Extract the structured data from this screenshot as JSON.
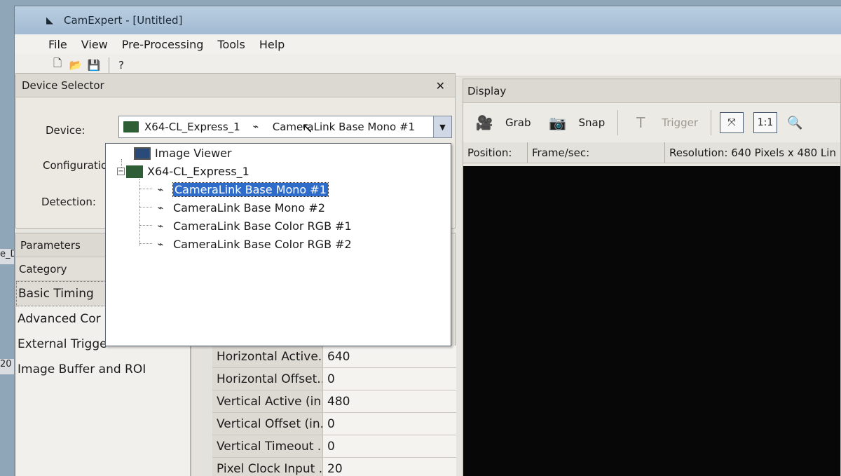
{
  "desktop": {
    "frag1": "e_D",
    "frag2": "20"
  },
  "window": {
    "title": "CamExpert - [Untitled]"
  },
  "menu": [
    "File",
    "View",
    "Pre-Processing",
    "Tools",
    "Help"
  ],
  "toolbar": {
    "icons": [
      "new-file-icon",
      "open-folder-icon",
      "save-icon",
      "help-icon"
    ]
  },
  "device_selector": {
    "header": "Device Selector",
    "device_label": "Device:",
    "configuration_label": "Configuration:",
    "detection_label": "Detection:",
    "selected_board": "X64-CL_Express_1",
    "selected_camera": "CameraLink Base Mono #1"
  },
  "dropdown": {
    "image_viewer": "Image Viewer",
    "board": "X64-CL_Express_1",
    "items": [
      "CameraLink Base Mono #1",
      "CameraLink Base Mono #2",
      "CameraLink Base Color RGB #1",
      "CameraLink Base Color RGB #2"
    ],
    "selected_index": 0
  },
  "parameters": {
    "header": "Parameters",
    "category_header": "Category",
    "categories": [
      "Basic Timing",
      "Advanced Cor",
      "External Trigge",
      "Image Buffer and ROI"
    ]
  },
  "grid": {
    "rows": [
      {
        "name": "Horizontal Active...",
        "value": "640"
      },
      {
        "name": "Horizontal Offset...",
        "value": "0"
      },
      {
        "name": "Vertical Active (in...",
        "value": "480"
      },
      {
        "name": "Vertical Offset (in...",
        "value": "0"
      },
      {
        "name": "Vertical Timeout ...",
        "value": "0"
      },
      {
        "name": "Pixel Clock Input ...",
        "value": "20"
      }
    ]
  },
  "display": {
    "header": "Display",
    "grab": "Grab",
    "snap": "Snap",
    "trigger": "Trigger",
    "one_to_one": "1:1",
    "position_label": "Position:",
    "fps_label": "Frame/sec:",
    "resolution": "Resolution: 640 Pixels x 480 Lin"
  }
}
